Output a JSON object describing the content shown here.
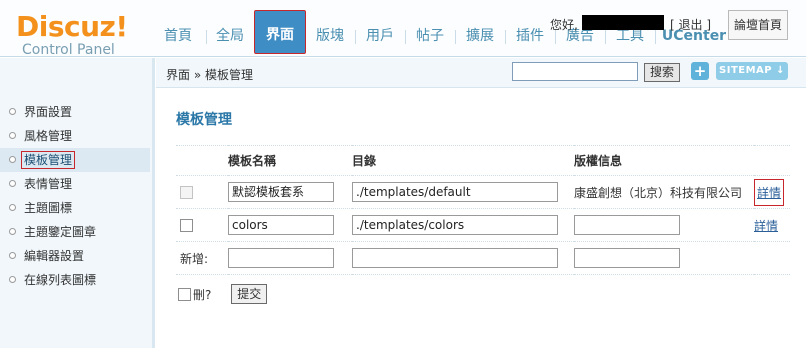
{
  "header": {
    "logo_text": "Discuz!",
    "logo_sub": "Control Panel",
    "nav": [
      "首頁",
      "全局",
      "界面",
      "版塊",
      "用戶",
      "帖子",
      "擴展",
      "插件",
      "廣告",
      "工具",
      "UCenter"
    ],
    "active_nav": "界面",
    "user_hello": "您好,",
    "logout_open": "[",
    "logout_label": "退出",
    "logout_close": "]",
    "forum_home": "論壇首頁"
  },
  "subbar": {
    "breadcrumb": "界面 » 模板管理",
    "search_button": "搜索",
    "plus_label": "+",
    "sitemap_label": "SITEMAP ↓"
  },
  "sidebar": {
    "items": [
      "界面設置",
      "風格管理",
      "模板管理",
      "表情管理",
      "主題圖標",
      "主題鑒定圖章",
      "編輯器設置",
      "在線列表圖標"
    ],
    "active": "模板管理"
  },
  "main": {
    "title": "模板管理",
    "columns": [
      "",
      "模板名稱",
      "目錄",
      "版權信息",
      ""
    ],
    "rows": [
      {
        "name": "默認模板套系",
        "dir": "./templates/default",
        "copyright": "康盛創想（北京）科技有限公司",
        "action": "詳情",
        "checkbox_disabled": true
      },
      {
        "name": "colors",
        "dir": "./templates/colors",
        "copyright": "",
        "action": "詳情",
        "checkbox_disabled": false
      }
    ],
    "new_label": "新增:",
    "delete_label": "刪?",
    "submit_label": "提交"
  },
  "colors": {
    "logo": "#f3911c",
    "nav_text": "#4b8fb1",
    "nav_active_bg": "#3e8dc4",
    "title": "#2b78a8",
    "highlight_border": "#c6262c"
  }
}
